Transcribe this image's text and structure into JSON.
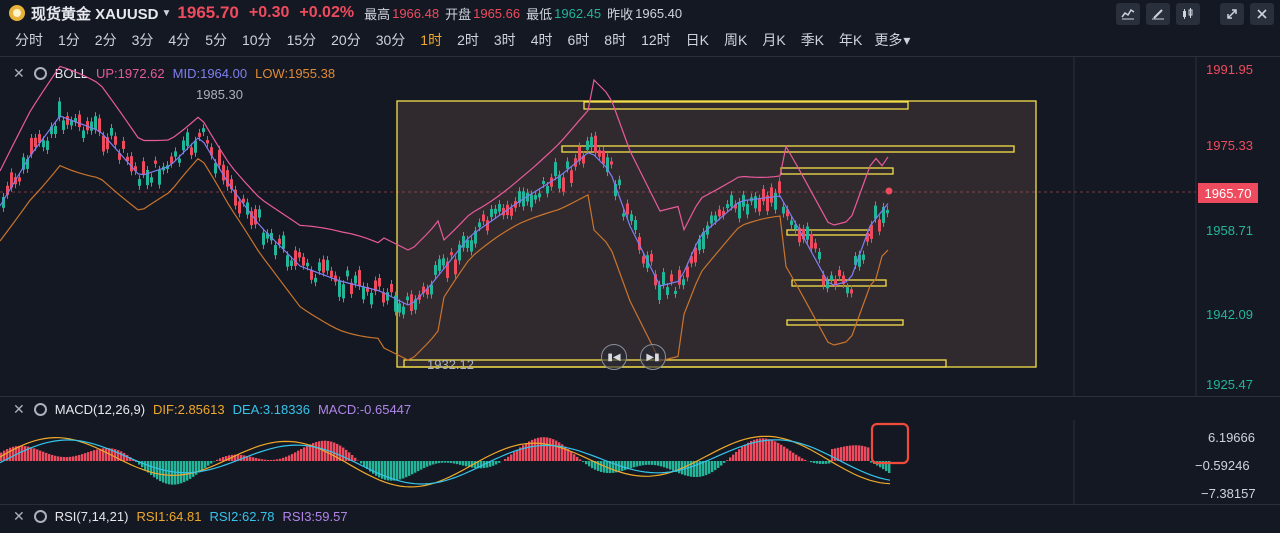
{
  "header": {
    "title": "现货黄金 XAUUSD",
    "price": "1965.70",
    "change": "+0.30",
    "change_pct": "+0.02%",
    "high_label": "最高",
    "high": "1966.48",
    "open_label": "开盘",
    "open": "1965.66",
    "low_label": "最低",
    "low": "1962.45",
    "prev_label": "昨收",
    "prev": "1965.40"
  },
  "toolbar": {
    "icons": [
      "chart-type-icon",
      "draw-pen-icon",
      "candlestick-icon",
      "expand-icon",
      "close-icon"
    ]
  },
  "timeframes": {
    "items": [
      "分时",
      "1分",
      "2分",
      "3分",
      "4分",
      "5分",
      "10分",
      "15分",
      "20分",
      "30分",
      "1时",
      "2时",
      "3时",
      "4时",
      "6时",
      "8时",
      "12时",
      "日K",
      "周K",
      "月K",
      "季K",
      "年K"
    ],
    "active": "1时",
    "more": "更多"
  },
  "boll": {
    "name": "BOLL",
    "up": "UP:1972.62",
    "mid": "MID:1964.00",
    "low": "LOW:1955.38"
  },
  "macd": {
    "name": "MACD(12,26,9)",
    "dif": "DIF:2.85613",
    "dea": "DEA:3.18336",
    "macd": "MACD:-0.65447"
  },
  "rsi": {
    "name": "RSI(7,14,21)",
    "rsi1": "RSI1:64.81",
    "rsi2": "RSI2:62.78",
    "rsi3": "RSI3:59.57"
  },
  "price_axis": {
    "labels": [
      "1991.95",
      "1975.33",
      "1958.71",
      "1942.09",
      "1925.47"
    ],
    "current": "1965.70"
  },
  "macd_axis": {
    "labels": [
      "6.19666",
      "−0.59246",
      "−7.38157"
    ]
  },
  "annotations": {
    "high_mark": "1985.30",
    "low_mark": "1932.12"
  },
  "colors": {
    "up": "#ef4b5e",
    "down": "#23b59a",
    "boll_up": "#e95a9a",
    "boll_mid": "#7f7ff0",
    "boll_low": "#e08a36",
    "dif": "#f0a92a",
    "dea": "#35c4ea",
    "highlight": "#f5e04a"
  }
}
